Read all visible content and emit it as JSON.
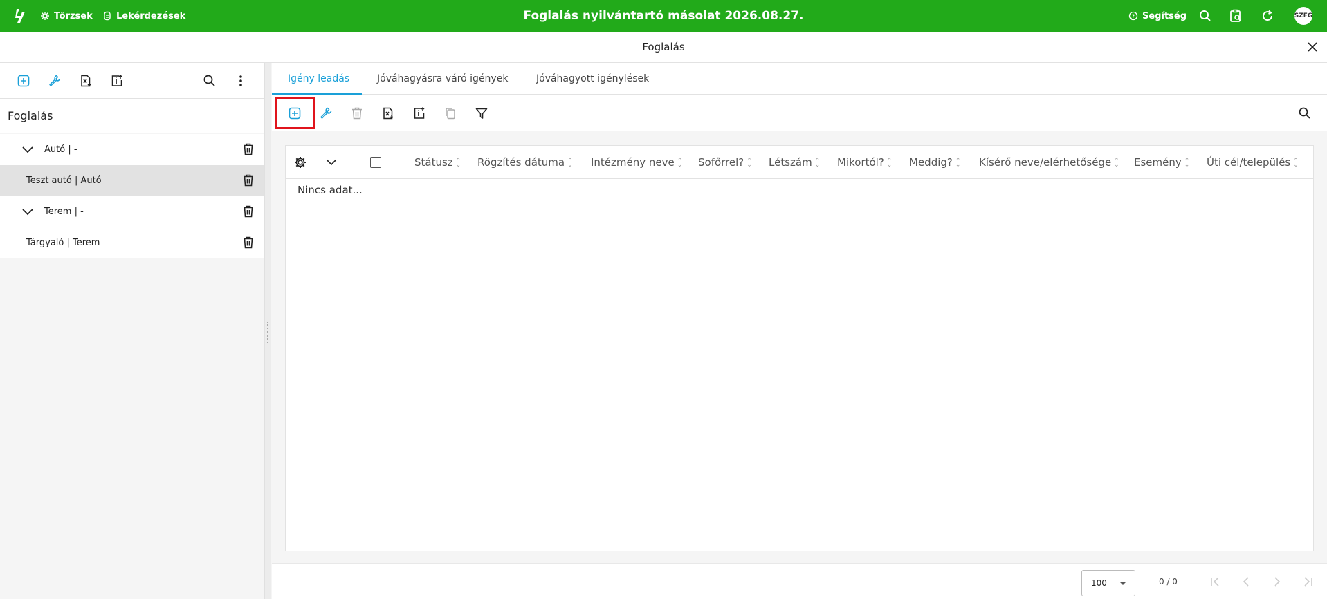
{
  "topbar": {
    "nav": [
      {
        "label": "Törzsek",
        "icon": "sparkle-icon"
      },
      {
        "label": "Lekérdezések",
        "icon": "query-icon"
      }
    ],
    "title": "Foglalás nyilvántartó másolat 2026.08.27.",
    "help_label": "Segítség",
    "avatar_text": "SZFG",
    "accent_color": "#22aa1a"
  },
  "window": {
    "title": "Foglalás"
  },
  "left_panel": {
    "title": "Foglalás",
    "items": [
      {
        "label": "Autó | -",
        "group": true
      },
      {
        "label": "Teszt autó | Autó",
        "group": false,
        "selected": true
      },
      {
        "label": "Terem | -",
        "group": true
      },
      {
        "label": "Tárgyaló | Terem",
        "group": false
      }
    ]
  },
  "tabs": [
    {
      "label": "Igény leadás",
      "active": true
    },
    {
      "label": "Jóváhagyásra váró igények"
    },
    {
      "label": "Jóváhagyott igénylések"
    }
  ],
  "grid": {
    "columns": [
      "Státusz",
      "Rögzítés dátuma",
      "Intézmény neve",
      "Sofőrrel?",
      "Létszám",
      "Mikortól?",
      "Meddig?",
      "Kísérő neve/elérhetősége",
      "Esemény",
      "Úti cél/település"
    ],
    "empty_text": "Nincs adat..."
  },
  "pager": {
    "page_size": "100",
    "count": "0 / 0"
  },
  "colors": {
    "link": "#1aa0d8",
    "highlight": "#e0141c"
  }
}
